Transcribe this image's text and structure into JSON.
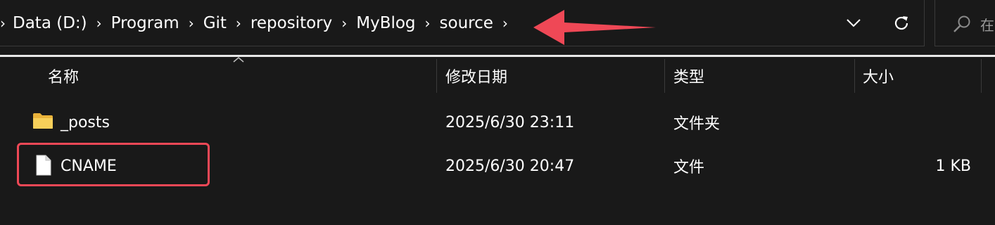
{
  "breadcrumb": {
    "items": [
      "Data (D:)",
      "Program",
      "Git",
      "repository",
      "MyBlog",
      "source"
    ]
  },
  "search": {
    "hint": "在"
  },
  "colors": {
    "annotation": "#ef4856",
    "folder": "#f2c44e"
  },
  "columns": {
    "name": "名称",
    "modified": "修改日期",
    "type": "类型",
    "size": "大小"
  },
  "files": [
    {
      "name": "_posts",
      "modified": "2025/6/30 23:11",
      "type": "文件夹",
      "size": "",
      "icon": "folder-icon"
    },
    {
      "name": "CNAME",
      "modified": "2025/6/30 20:47",
      "type": "文件",
      "size": "1 KB",
      "icon": "file-icon"
    }
  ]
}
